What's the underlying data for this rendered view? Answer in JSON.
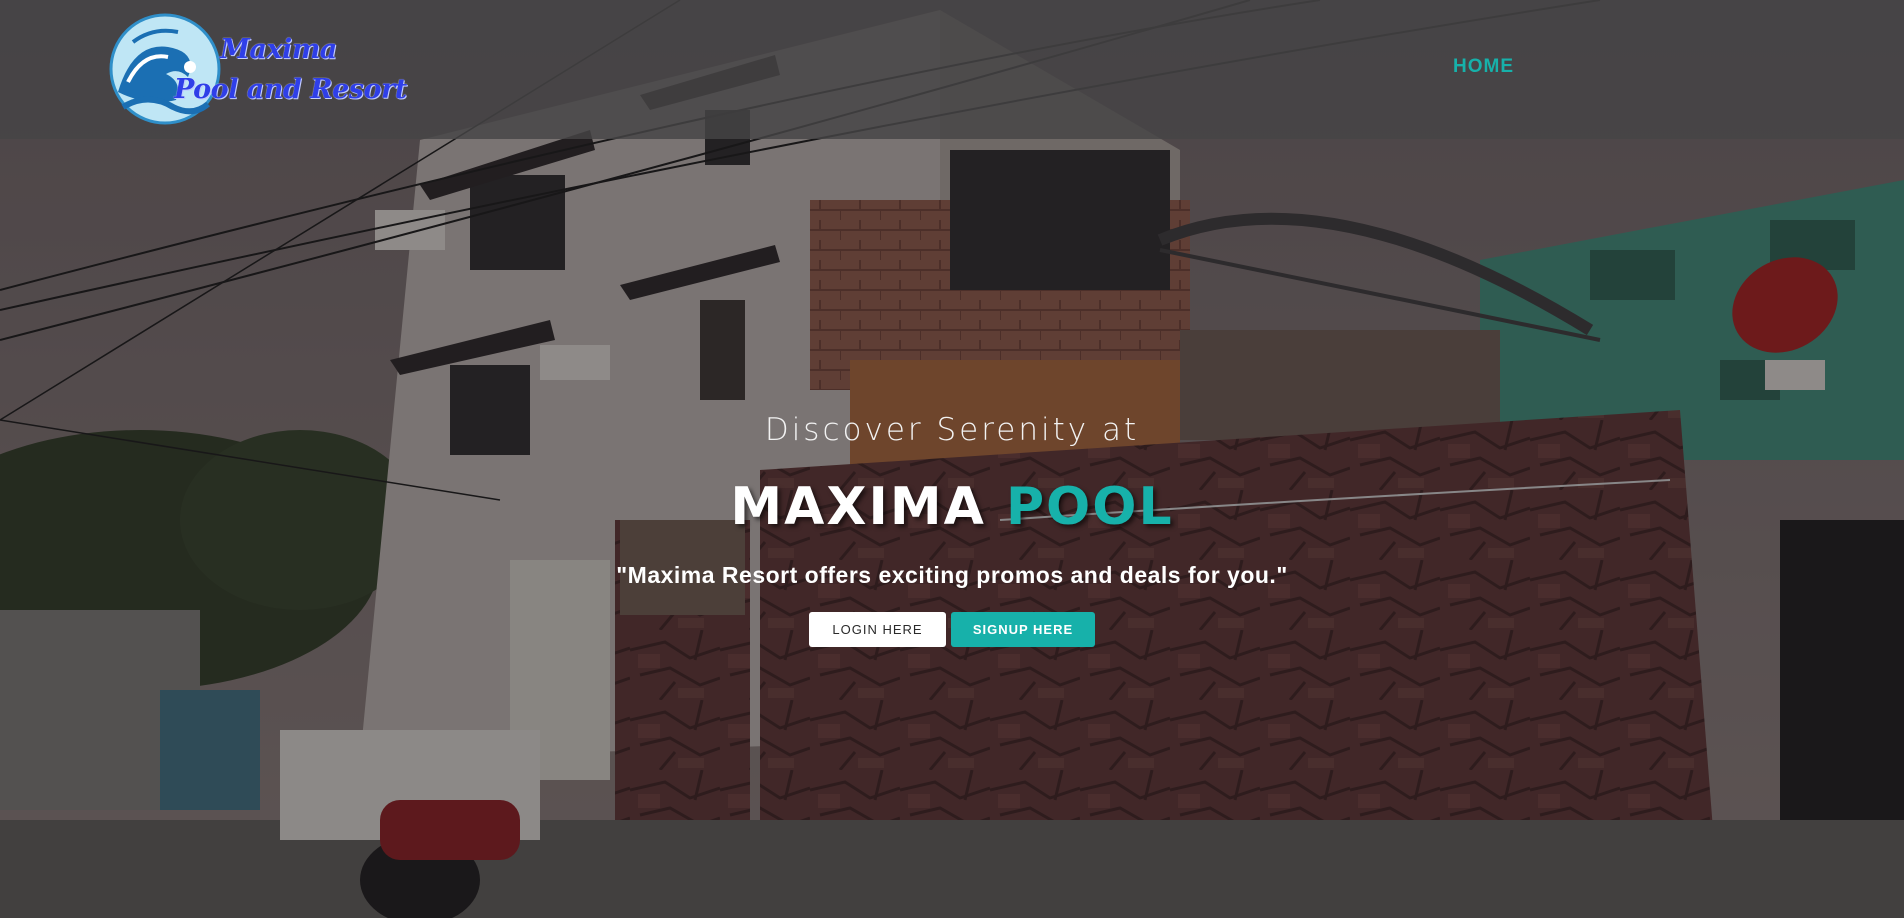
{
  "header": {
    "logo": {
      "line1": "Maxima",
      "line2": "Pool and Resort",
      "icon": "wave-icon"
    },
    "nav": [
      {
        "label": "HOME",
        "active": true
      }
    ]
  },
  "hero": {
    "pretitle": "Discover Serenity at",
    "title_main": "MAXIMA",
    "title_accent": "POOL",
    "quote": "\"Maxima Resort offers exciting promos and deals for you.\"",
    "buttons": {
      "login": "LOGIN HERE",
      "signup": "SIGNUP HERE"
    }
  },
  "colors": {
    "accent": "#17b1aa",
    "header_bg": "#464446",
    "logo_text": "#2f3fe8",
    "button_light": "#ffffff"
  }
}
